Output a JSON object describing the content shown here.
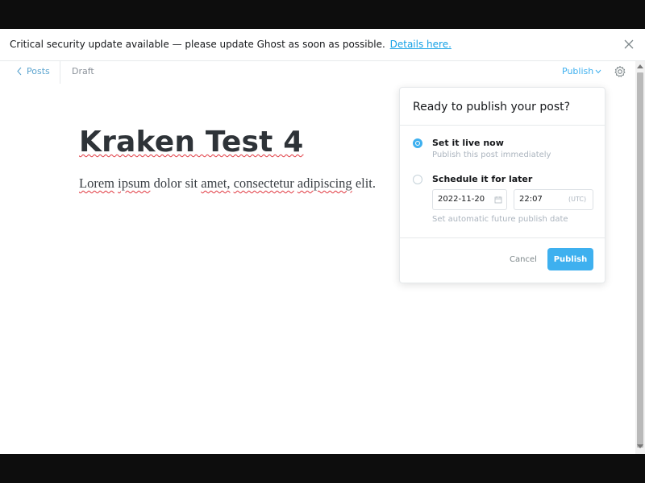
{
  "alert": {
    "message": "Critical security update available — please update Ghost as soon as possible.",
    "link_text": "Details here."
  },
  "header": {
    "back_label": "Posts",
    "status": "Draft",
    "publish_menu_label": "Publish"
  },
  "post": {
    "title": "Kraken Test 4",
    "body_words": [
      "Lorem",
      "ipsum",
      "dolor",
      "sit",
      "amet,",
      "consectetur",
      "adipiscing",
      "elit."
    ]
  },
  "publish_popover": {
    "title": "Ready to publish your post?",
    "option_now": {
      "label": "Set it live now",
      "description": "Publish this post immediately",
      "selected": true
    },
    "option_schedule": {
      "label": "Schedule it for later",
      "description": "Set automatic future publish date",
      "selected": false
    },
    "date_value": "2022-11-20",
    "time_value": "22:07",
    "timezone": "(UTC)",
    "cancel_label": "Cancel",
    "publish_label": "Publish"
  },
  "colors": {
    "accent": "#3eb0ef",
    "link": "#14a1e6",
    "title_text": "#2e3338"
  }
}
